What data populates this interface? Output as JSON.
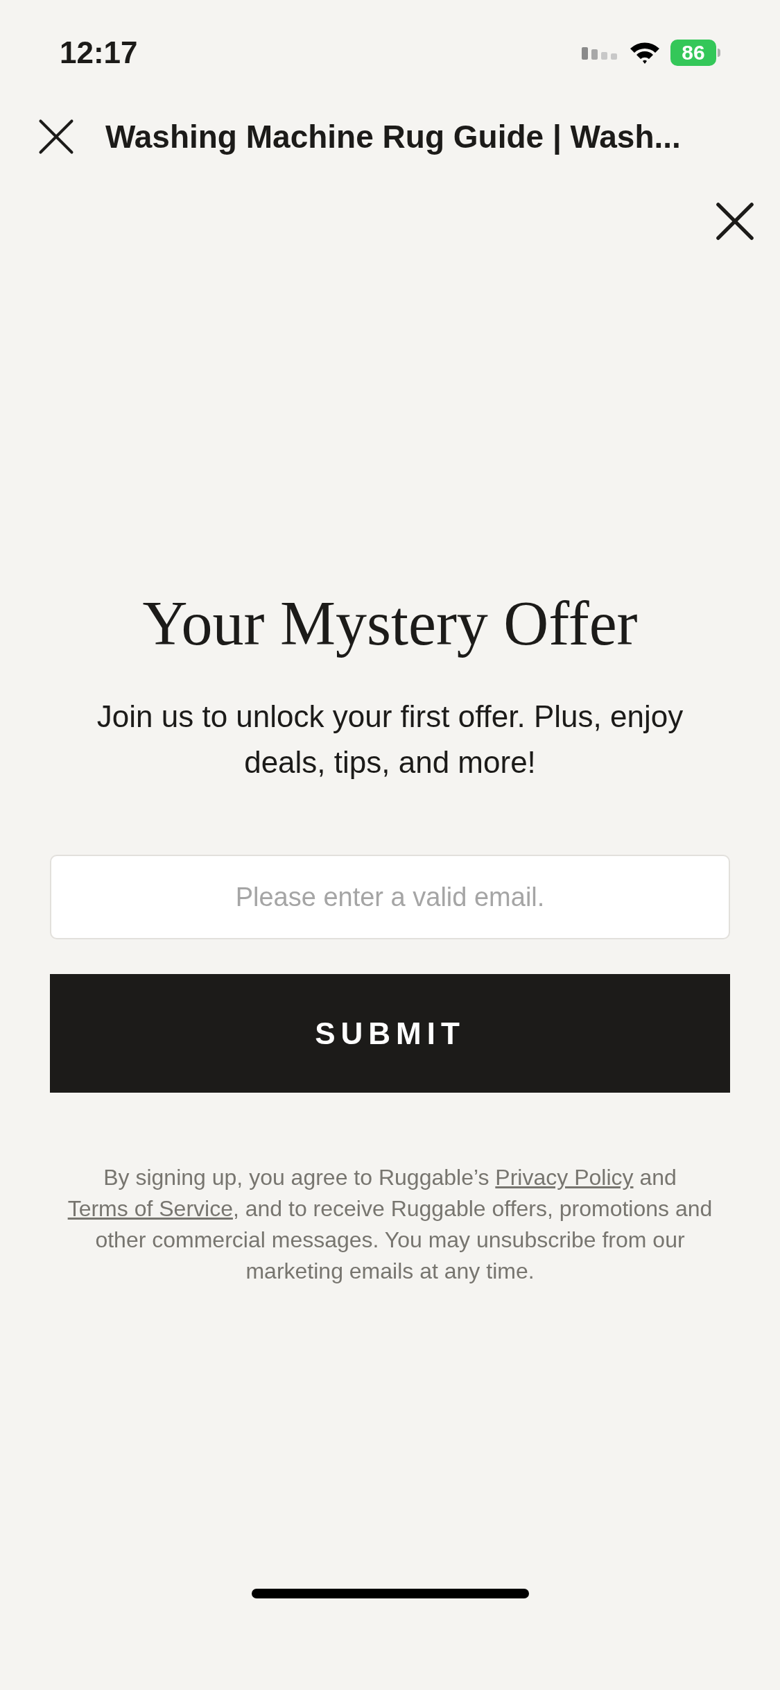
{
  "status_bar": {
    "time": "12:17",
    "battery": "86"
  },
  "browser_bar": {
    "title": "Washing Machine Rug Guide | Wash..."
  },
  "popup": {
    "heading": "Your Mystery Offer",
    "subtitle": "Join us to unlock your first offer. Plus, enjoy deals, tips, and more!",
    "email": {
      "placeholder": "Please enter a valid email."
    },
    "submit": "SUBMIT",
    "legal": {
      "before": "By signing up, you agree to Ruggable’s",
      "privacy_link": "Privacy Policy",
      "middle": "and",
      "terms_link": "Terms of Service",
      "after": ", and to receive Ruggable offers, promotions and other commercial messages. You may unsubscribe from our marketing emails at any time."
    }
  }
}
